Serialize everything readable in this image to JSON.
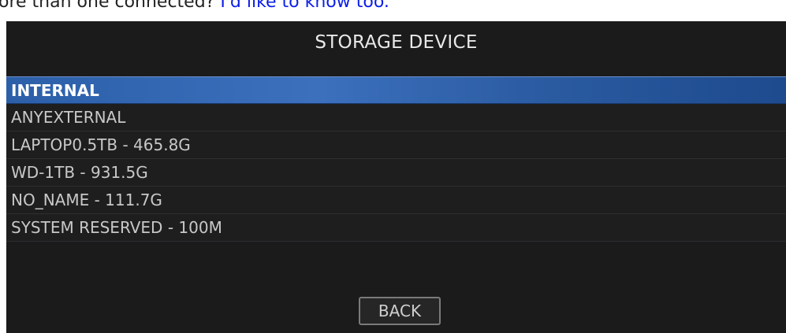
{
  "fragment": {
    "text": "ore than one connected? ",
    "link": "I'd like to know too."
  },
  "dialog": {
    "title": "STORAGE DEVICE",
    "items": [
      {
        "label": "INTERNAL",
        "selected": true
      },
      {
        "label": "ANYEXTERNAL",
        "selected": false
      },
      {
        "label": "LAPTOP0.5TB - 465.8G",
        "selected": false
      },
      {
        "label": "WD-1TB - 931.5G",
        "selected": false
      },
      {
        "label": "NO_NAME - 111.7G",
        "selected": false
      },
      {
        "label": "SYSTEM RESERVED - 100M",
        "selected": false
      }
    ],
    "back_label": "BACK"
  },
  "colors": {
    "panel_background": "#1b1b1c",
    "selection": "#3c70bd",
    "text": "#c8c8c8",
    "link": "#0a1ee8"
  }
}
